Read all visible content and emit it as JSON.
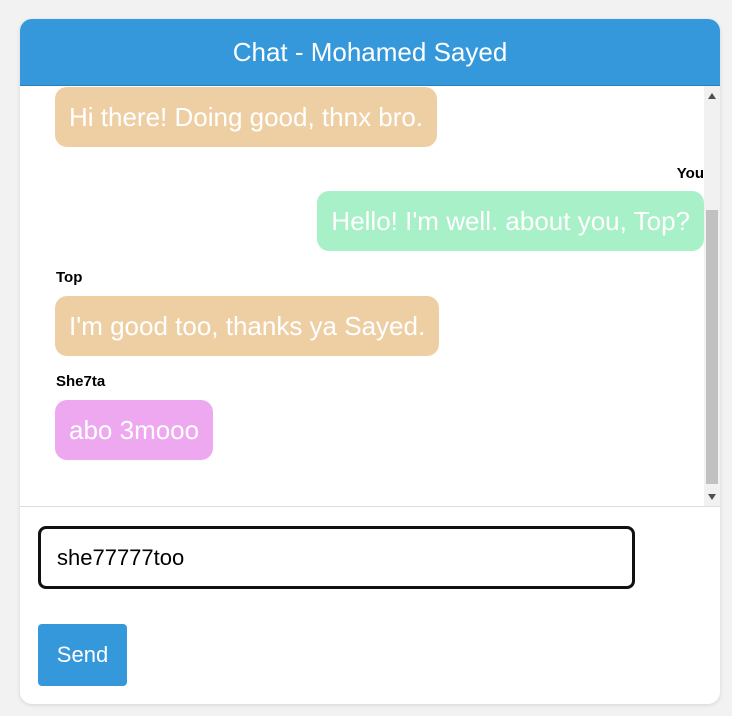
{
  "header": {
    "title": "Chat - Mohamed Sayed"
  },
  "messages": [
    {
      "sender": "",
      "text": "Hi there! Doing good, thnx bro.",
      "color": "#eecfa4"
    },
    {
      "sender": "You",
      "text": "Hello! I'm well. about you, Top?",
      "color": "#a8f0c8"
    },
    {
      "sender": "Top",
      "text": "I'm good too, thanks ya Sayed.",
      "color": "#eecfa4"
    },
    {
      "sender": "She7ta",
      "text": "abo 3mooo",
      "color": "#eea8f0"
    }
  ],
  "composer": {
    "input_value": "she77777too",
    "send_label": "Send"
  },
  "colors": {
    "accent": "#3498db"
  },
  "icons": {
    "scroll_up": "triangle-up-icon",
    "scroll_down": "triangle-down-icon"
  }
}
